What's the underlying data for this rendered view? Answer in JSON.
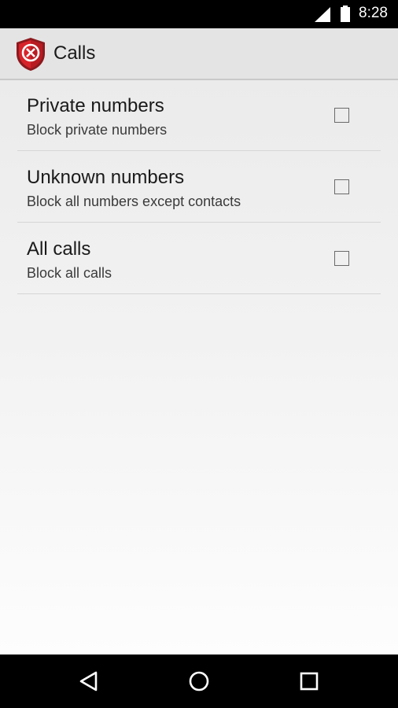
{
  "status_bar": {
    "time": "8:28",
    "icons": [
      "signal-icon",
      "battery-icon"
    ]
  },
  "action_bar": {
    "icon": "shield-block-icon",
    "title": "Calls",
    "colors": {
      "shield": "#d8232a",
      "shield_border": "#8c1a1e"
    }
  },
  "preferences": [
    {
      "title": "Private numbers",
      "summary": "Block private numbers",
      "checked": false
    },
    {
      "title": "Unknown numbers",
      "summary": "Block all numbers except contacts",
      "checked": false
    },
    {
      "title": "All calls",
      "summary": "Block all calls",
      "checked": false
    }
  ],
  "nav_bar": {
    "buttons": [
      "back-icon",
      "home-icon",
      "recents-icon"
    ]
  }
}
